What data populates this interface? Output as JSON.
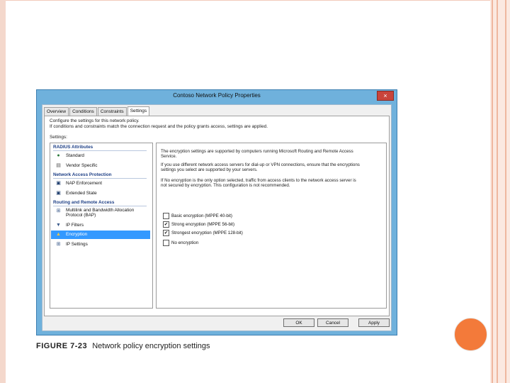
{
  "dialog": {
    "title": "Contoso Network Policy Properties",
    "close_glyph": "×",
    "tabs": [
      "Overview",
      "Conditions",
      "Constraints",
      "Settings"
    ],
    "active_tab": "Settings",
    "intro_line1": "Configure the settings for this network policy.",
    "intro_line2": "If conditions and constraints match the connection request and the policy grants access, settings are applied.",
    "settings_label": "Settings:",
    "sidebar": {
      "sections": [
        {
          "title": "RADIUS Attributes",
          "items": [
            {
              "label": "Standard",
              "icon": "globe-icon"
            },
            {
              "label": "Vendor Specific",
              "icon": "document-icon"
            }
          ]
        },
        {
          "title": "Network Access Protection",
          "items": [
            {
              "label": "NAP Enforcement",
              "icon": "monitor-icon"
            },
            {
              "label": "Extended State",
              "icon": "monitor-icon"
            }
          ]
        },
        {
          "title": "Routing and Remote Access",
          "items": [
            {
              "label": "Multilink and Bandwidth Allocation Protocol (BAP)",
              "icon": "network-icon"
            },
            {
              "label": "IP Filters",
              "icon": "filter-icon"
            },
            {
              "label": "Encryption",
              "icon": "lock-icon"
            },
            {
              "label": "IP Settings",
              "icon": "network-icon"
            }
          ]
        }
      ],
      "selected": "Encryption"
    },
    "content": {
      "para1": "The encryption settings are supported by computers running Microsoft Routing and Remote Access Service.",
      "para2": "If you use different network access servers for dial-up or VPN connections, ensure that the encryptions settings you select are supported by your servers.",
      "para3": "If No encryption is the only option selected, traffic from access clients to the network access server is not secured by encryption. This configuration is not recommended.",
      "options": [
        {
          "label": "Basic encryption (MPPE 40-bit)",
          "checked": false
        },
        {
          "label": "Strong encryption (MPPE 56-bit)",
          "checked": true
        },
        {
          "label": "Strongest encryption (MPPE 128-bit)",
          "checked": true
        },
        {
          "label": "No encryption",
          "checked": false
        }
      ],
      "check_glyph": "✔"
    },
    "buttons": {
      "ok": "OK",
      "cancel": "Cancel",
      "apply": "Apply"
    }
  },
  "caption": {
    "figure": "FIGURE 7-23",
    "text": "Network policy encryption settings"
  },
  "colors": {
    "accent_orange": "#f37a3a",
    "title_bar": "#6fb1dc",
    "selection": "#3399ff",
    "section_heading": "#1d3f86"
  }
}
